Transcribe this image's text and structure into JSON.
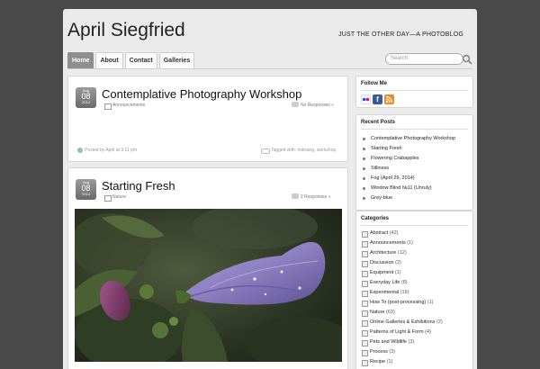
{
  "header": {
    "site_title": "April Siegfried",
    "tagline": "JUST THE OTHER DAY—A PHOTOBLOG"
  },
  "nav": {
    "items": [
      "Home",
      "About",
      "Contact",
      "Galleries"
    ],
    "active": "Home"
  },
  "search": {
    "placeholder": "Search"
  },
  "posts": [
    {
      "date": {
        "month": "Aug",
        "day": "08",
        "year": "2014"
      },
      "title": "Contemplative Photography Workshop",
      "category": "Announcements",
      "responses": "No Responses »",
      "meta": "Posted by April at 3:11 pm",
      "tags": "Tagged with: miksang, workshop"
    },
    {
      "date": {
        "month": "Aug",
        "day": "08",
        "year": "2014"
      },
      "title": "Starting Fresh",
      "category": "Nature",
      "responses": "2 Responses »"
    }
  ],
  "sidebar": {
    "follow": {
      "title": "Follow Me",
      "icons": [
        {
          "name": "flickr-icon",
          "color": "#ffffff"
        },
        {
          "name": "facebook-icon",
          "color": "#3b5998"
        },
        {
          "name": "rss-icon",
          "color": "#f08a24"
        }
      ]
    },
    "recent": {
      "title": "Recent Posts",
      "items": [
        "Contemplative Photography Workshop",
        "Starting Fresh",
        "Flowering Crabapples",
        "Silliness",
        "Fog (April 29, 2014)",
        "Window Blind №11 (Unruly)",
        "Grey-blue"
      ]
    },
    "categories": {
      "title": "Categories",
      "items": [
        {
          "name": "Abstract",
          "count": "(42)"
        },
        {
          "name": "Announcements",
          "count": "(1)"
        },
        {
          "name": "Architecture",
          "count": "(12)"
        },
        {
          "name": "Discussion",
          "count": "(2)"
        },
        {
          "name": "Equipment",
          "count": "(1)"
        },
        {
          "name": "Everyday Life",
          "count": "(8)"
        },
        {
          "name": "Experimental",
          "count": "(19)"
        },
        {
          "name": "How To (post-processing)",
          "count": "(1)"
        },
        {
          "name": "Nature",
          "count": "(63)"
        },
        {
          "name": "Online Galleries & Exhibitions",
          "count": "(2)"
        },
        {
          "name": "Patterns of Light & Form",
          "count": "(4)"
        },
        {
          "name": "Pets and Wildlife",
          "count": "(3)"
        },
        {
          "name": "Process",
          "count": "(3)"
        },
        {
          "name": "Recipe",
          "count": "(1)"
        }
      ]
    }
  },
  "colors": {
    "accent": "#8e8e8e",
    "background": "#4a4a4a",
    "flower": "#8b7fc0"
  }
}
